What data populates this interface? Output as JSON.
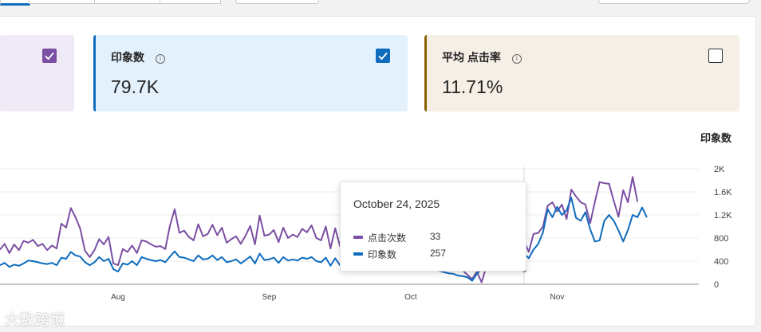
{
  "cards": [
    {
      "label": "",
      "value": "",
      "checked": true,
      "color": "#7b4fa3",
      "bg": "#f0eaf6"
    },
    {
      "label": "印象数",
      "value": "79.7K",
      "checked": true,
      "color": "#0f6cbd",
      "bg": "#e3f1fc"
    },
    {
      "label": "平均 点击率",
      "value": "11.71%",
      "checked": false,
      "color": "#8a6000",
      "bg": "#f5efe5"
    }
  ],
  "chart_data": {
    "type": "line",
    "ylabel": "印象数",
    "ylim": [
      0,
      2000
    ],
    "y_ticks": [
      "0",
      "400",
      "800",
      "1.2K",
      "1.6K",
      "2K"
    ],
    "x_ticks": [
      {
        "label": "Aug",
        "day": 0
      },
      {
        "label": "Sep",
        "day": 32
      },
      {
        "label": "Oct",
        "day": 62
      },
      {
        "label": "Nov",
        "day": 93
      }
    ],
    "x_range_days": [
      -25,
      123
    ],
    "grid": true,
    "series": [
      {
        "name": "点击次数",
        "color": "#7b4fa3",
        "values": [
          [
            -25,
            600
          ],
          [
            -24,
            700
          ],
          [
            -23,
            540
          ],
          [
            -22,
            690
          ],
          [
            -21,
            590
          ],
          [
            -20,
            750
          ],
          [
            -19,
            720
          ],
          [
            -18,
            770
          ],
          [
            -17,
            660
          ],
          [
            -16,
            700
          ],
          [
            -15,
            590
          ],
          [
            -14,
            670
          ],
          [
            -13,
            620
          ],
          [
            -12,
            1050
          ],
          [
            -11,
            980
          ],
          [
            -10,
            1320
          ],
          [
            -9,
            1160
          ],
          [
            -8,
            960
          ],
          [
            -7,
            580
          ],
          [
            -6,
            470
          ],
          [
            -5,
            590
          ],
          [
            -4,
            780
          ],
          [
            -3,
            690
          ],
          [
            -2,
            820
          ],
          [
            -1,
            360
          ],
          [
            0,
            330
          ],
          [
            1,
            610
          ],
          [
            2,
            560
          ],
          [
            3,
            670
          ],
          [
            4,
            540
          ],
          [
            5,
            760
          ],
          [
            6,
            740
          ],
          [
            7,
            690
          ],
          [
            8,
            650
          ],
          [
            9,
            660
          ],
          [
            10,
            610
          ],
          [
            11,
            1020
          ],
          [
            12,
            1300
          ],
          [
            13,
            890
          ],
          [
            14,
            930
          ],
          [
            15,
            820
          ],
          [
            16,
            760
          ],
          [
            17,
            1040
          ],
          [
            18,
            830
          ],
          [
            19,
            870
          ],
          [
            20,
            1030
          ],
          [
            21,
            850
          ],
          [
            22,
            980
          ],
          [
            23,
            720
          ],
          [
            24,
            780
          ],
          [
            25,
            830
          ],
          [
            26,
            700
          ],
          [
            27,
            840
          ],
          [
            28,
            1010
          ],
          [
            29,
            690
          ],
          [
            30,
            1190
          ],
          [
            31,
            840
          ],
          [
            32,
            860
          ],
          [
            33,
            940
          ],
          [
            34,
            730
          ],
          [
            35,
            980
          ],
          [
            36,
            800
          ],
          [
            37,
            860
          ],
          [
            38,
            820
          ],
          [
            39,
            960
          ],
          [
            40,
            900
          ],
          [
            41,
            1020
          ],
          [
            42,
            800
          ],
          [
            43,
            760
          ],
          [
            44,
            1000
          ],
          [
            45,
            620
          ],
          [
            46,
            970
          ],
          [
            47,
            660
          ],
          [
            48,
            940
          ],
          [
            49,
            760
          ],
          [
            50,
            1000
          ],
          [
            51,
            820
          ],
          [
            52,
            930
          ],
          [
            53,
            780
          ],
          [
            54,
            800
          ],
          [
            55,
            770
          ],
          [
            56,
            690
          ],
          [
            57,
            720
          ],
          [
            58,
            760
          ],
          [
            59,
            620
          ],
          [
            60,
            700
          ],
          [
            61,
            640
          ],
          [
            62,
            590
          ],
          [
            63,
            520
          ],
          [
            64,
            560
          ],
          [
            65,
            480
          ],
          [
            66,
            520
          ],
          [
            67,
            460
          ],
          [
            68,
            420
          ],
          [
            69,
            380
          ],
          [
            70,
            330
          ],
          [
            71,
            320
          ],
          [
            72,
            260
          ],
          [
            73,
            240
          ],
          [
            74,
            160
          ],
          [
            75,
            90
          ],
          [
            76,
            220
          ],
          [
            77,
            33
          ],
          [
            78,
            300
          ],
          [
            79,
            440
          ],
          [
            80,
            380
          ],
          [
            81,
            480
          ],
          [
            82,
            540
          ],
          [
            83,
            500
          ],
          [
            84,
            620
          ],
          [
            85,
            530
          ],
          [
            86,
            750
          ],
          [
            87,
            560
          ],
          [
            88,
            870
          ],
          [
            89,
            890
          ],
          [
            90,
            1000
          ],
          [
            91,
            1360
          ],
          [
            92,
            1420
          ],
          [
            93,
            1260
          ],
          [
            94,
            1380
          ],
          [
            95,
            1130
          ],
          [
            96,
            1640
          ],
          [
            97,
            1520
          ],
          [
            98,
            1420
          ],
          [
            99,
            1380
          ],
          [
            100,
            1060
          ],
          [
            101,
            1430
          ],
          [
            102,
            1770
          ],
          [
            103,
            1750
          ],
          [
            104,
            1740
          ],
          [
            105,
            1440
          ],
          [
            106,
            1170
          ],
          [
            107,
            1630
          ],
          [
            108,
            1420
          ],
          [
            109,
            1860
          ],
          [
            110,
            1430
          ]
        ]
      },
      {
        "name": "印象数",
        "color": "#0f6cbd",
        "values": [
          [
            -25,
            330
          ],
          [
            -24,
            370
          ],
          [
            -23,
            300
          ],
          [
            -22,
            340
          ],
          [
            -21,
            320
          ],
          [
            -20,
            360
          ],
          [
            -19,
            410
          ],
          [
            -18,
            400
          ],
          [
            -17,
            380
          ],
          [
            -16,
            360
          ],
          [
            -15,
            350
          ],
          [
            -14,
            370
          ],
          [
            -13,
            330
          ],
          [
            -12,
            460
          ],
          [
            -11,
            440
          ],
          [
            -10,
            560
          ],
          [
            -9,
            500
          ],
          [
            -8,
            480
          ],
          [
            -7,
            380
          ],
          [
            -6,
            330
          ],
          [
            -5,
            380
          ],
          [
            -4,
            470
          ],
          [
            -3,
            400
          ],
          [
            -2,
            440
          ],
          [
            -1,
            260
          ],
          [
            0,
            220
          ],
          [
            1,
            360
          ],
          [
            2,
            340
          ],
          [
            3,
            400
          ],
          [
            4,
            330
          ],
          [
            5,
            470
          ],
          [
            6,
            440
          ],
          [
            7,
            420
          ],
          [
            8,
            400
          ],
          [
            9,
            420
          ],
          [
            10,
            380
          ],
          [
            11,
            480
          ],
          [
            12,
            570
          ],
          [
            13,
            470
          ],
          [
            14,
            460
          ],
          [
            15,
            430
          ],
          [
            16,
            400
          ],
          [
            17,
            500
          ],
          [
            18,
            430
          ],
          [
            19,
            440
          ],
          [
            20,
            500
          ],
          [
            21,
            420
          ],
          [
            22,
            470
          ],
          [
            23,
            380
          ],
          [
            24,
            400
          ],
          [
            25,
            430
          ],
          [
            26,
            360
          ],
          [
            27,
            420
          ],
          [
            28,
            480
          ],
          [
            29,
            360
          ],
          [
            30,
            530
          ],
          [
            31,
            420
          ],
          [
            32,
            430
          ],
          [
            33,
            460
          ],
          [
            34,
            370
          ],
          [
            35,
            470
          ],
          [
            36,
            410
          ],
          [
            37,
            430
          ],
          [
            38,
            410
          ],
          [
            39,
            460
          ],
          [
            40,
            440
          ],
          [
            41,
            470
          ],
          [
            42,
            400
          ],
          [
            43,
            380
          ],
          [
            44,
            460
          ],
          [
            45,
            320
          ],
          [
            46,
            450
          ],
          [
            47,
            330
          ],
          [
            48,
            430
          ],
          [
            49,
            370
          ],
          [
            50,
            460
          ],
          [
            51,
            400
          ],
          [
            52,
            440
          ],
          [
            53,
            380
          ],
          [
            54,
            390
          ],
          [
            55,
            380
          ],
          [
            56,
            350
          ],
          [
            57,
            360
          ],
          [
            58,
            380
          ],
          [
            59,
            320
          ],
          [
            60,
            350
          ],
          [
            61,
            330
          ],
          [
            62,
            300
          ],
          [
            63,
            280
          ],
          [
            64,
            290
          ],
          [
            65,
            260
          ],
          [
            66,
            270
          ],
          [
            67,
            250
          ],
          [
            68,
            230
          ],
          [
            69,
            210
          ],
          [
            70,
            190
          ],
          [
            71,
            180
          ],
          [
            72,
            150
          ],
          [
            73,
            140
          ],
          [
            74,
            120
          ],
          [
            75,
            60
          ],
          [
            76,
            180
          ],
          [
            77,
            257
          ],
          [
            78,
            240
          ],
          [
            79,
            300
          ],
          [
            80,
            330
          ],
          [
            81,
            360
          ],
          [
            82,
            400
          ],
          [
            83,
            380
          ],
          [
            84,
            450
          ],
          [
            85,
            400
          ],
          [
            86,
            530
          ],
          [
            87,
            450
          ],
          [
            88,
            600
          ],
          [
            89,
            700
          ],
          [
            90,
            900
          ],
          [
            91,
            1300
          ],
          [
            92,
            1160
          ],
          [
            93,
            1340
          ],
          [
            94,
            1200
          ],
          [
            95,
            1280
          ],
          [
            96,
            1500
          ],
          [
            97,
            1150
          ],
          [
            98,
            1100
          ],
          [
            99,
            1250
          ],
          [
            100,
            950
          ],
          [
            101,
            740
          ],
          [
            102,
            760
          ],
          [
            103,
            1100
          ],
          [
            104,
            1200
          ],
          [
            105,
            1100
          ],
          [
            106,
            930
          ],
          [
            107,
            740
          ],
          [
            108,
            940
          ],
          [
            109,
            1200
          ],
          [
            110,
            1160
          ],
          [
            111,
            1330
          ],
          [
            112,
            1160
          ]
        ]
      }
    ]
  },
  "tooltip": {
    "date": "October 24, 2025",
    "rows": [
      {
        "name": "点击次数",
        "value": "33",
        "color": "#7b4fa3"
      },
      {
        "name": "印象数",
        "value": "257",
        "color": "#0f6cbd"
      }
    ]
  },
  "watermark": "大数跨境"
}
